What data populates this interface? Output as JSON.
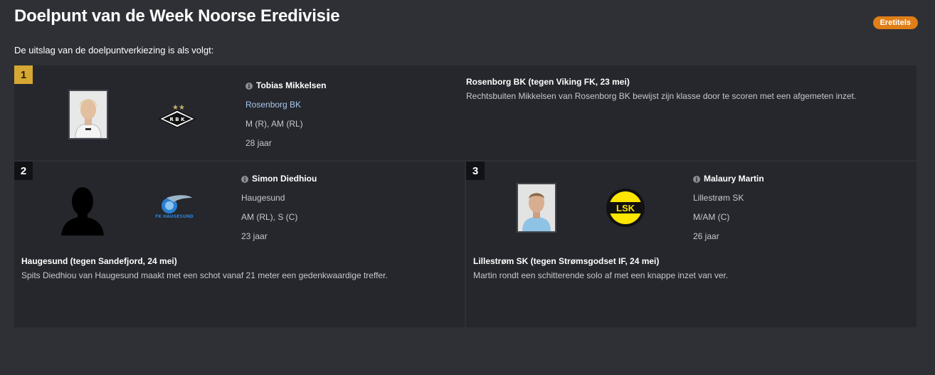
{
  "header": {
    "title": "Doelpunt van de Week Noorse Eredivisie",
    "badge": "Eretitels",
    "intro": "De uitslag van de doelpuntverkiezing is als volgt:"
  },
  "entries": [
    {
      "rank": "1",
      "player": "Tobias Mikkelsen",
      "club": "Rosenborg BK",
      "position": "M (R), AM (RL)",
      "age": "28 jaar",
      "match": "Rosenborg BK (tegen Viking FK, 23 mei)",
      "description": "Rechtsbuiten Mikkelsen van Rosenborg BK bewijst zijn klasse door te scoren met een afgemeten inzet.",
      "logo_text": "R B K"
    },
    {
      "rank": "2",
      "player": "Simon Diedhiou",
      "club": "Haugesund",
      "position": "AM (RL), S (C)",
      "age": "23 jaar",
      "match": "Haugesund (tegen Sandefjord, 24 mei)",
      "description": "Spits Diedhiou van Haugesund maakt met een schot vanaf 21 meter een gedenkwaardige treffer.",
      "logo_text": "FK HAUGESUND"
    },
    {
      "rank": "3",
      "player": "Malaury Martin",
      "club": "Lillestrøm SK",
      "position": "M/AM (C)",
      "age": "26 jaar",
      "match": "Lillestrøm SK (tegen Strømsgodset IF, 24 mei)",
      "description": "Martin rondt een schitterende solo af met een knappe inzet van ver.",
      "logo_text": "LSK"
    }
  ],
  "icons": {
    "info": "info-icon",
    "rank_gold_color": "#d6a833",
    "badge_color": "#e07e17"
  }
}
